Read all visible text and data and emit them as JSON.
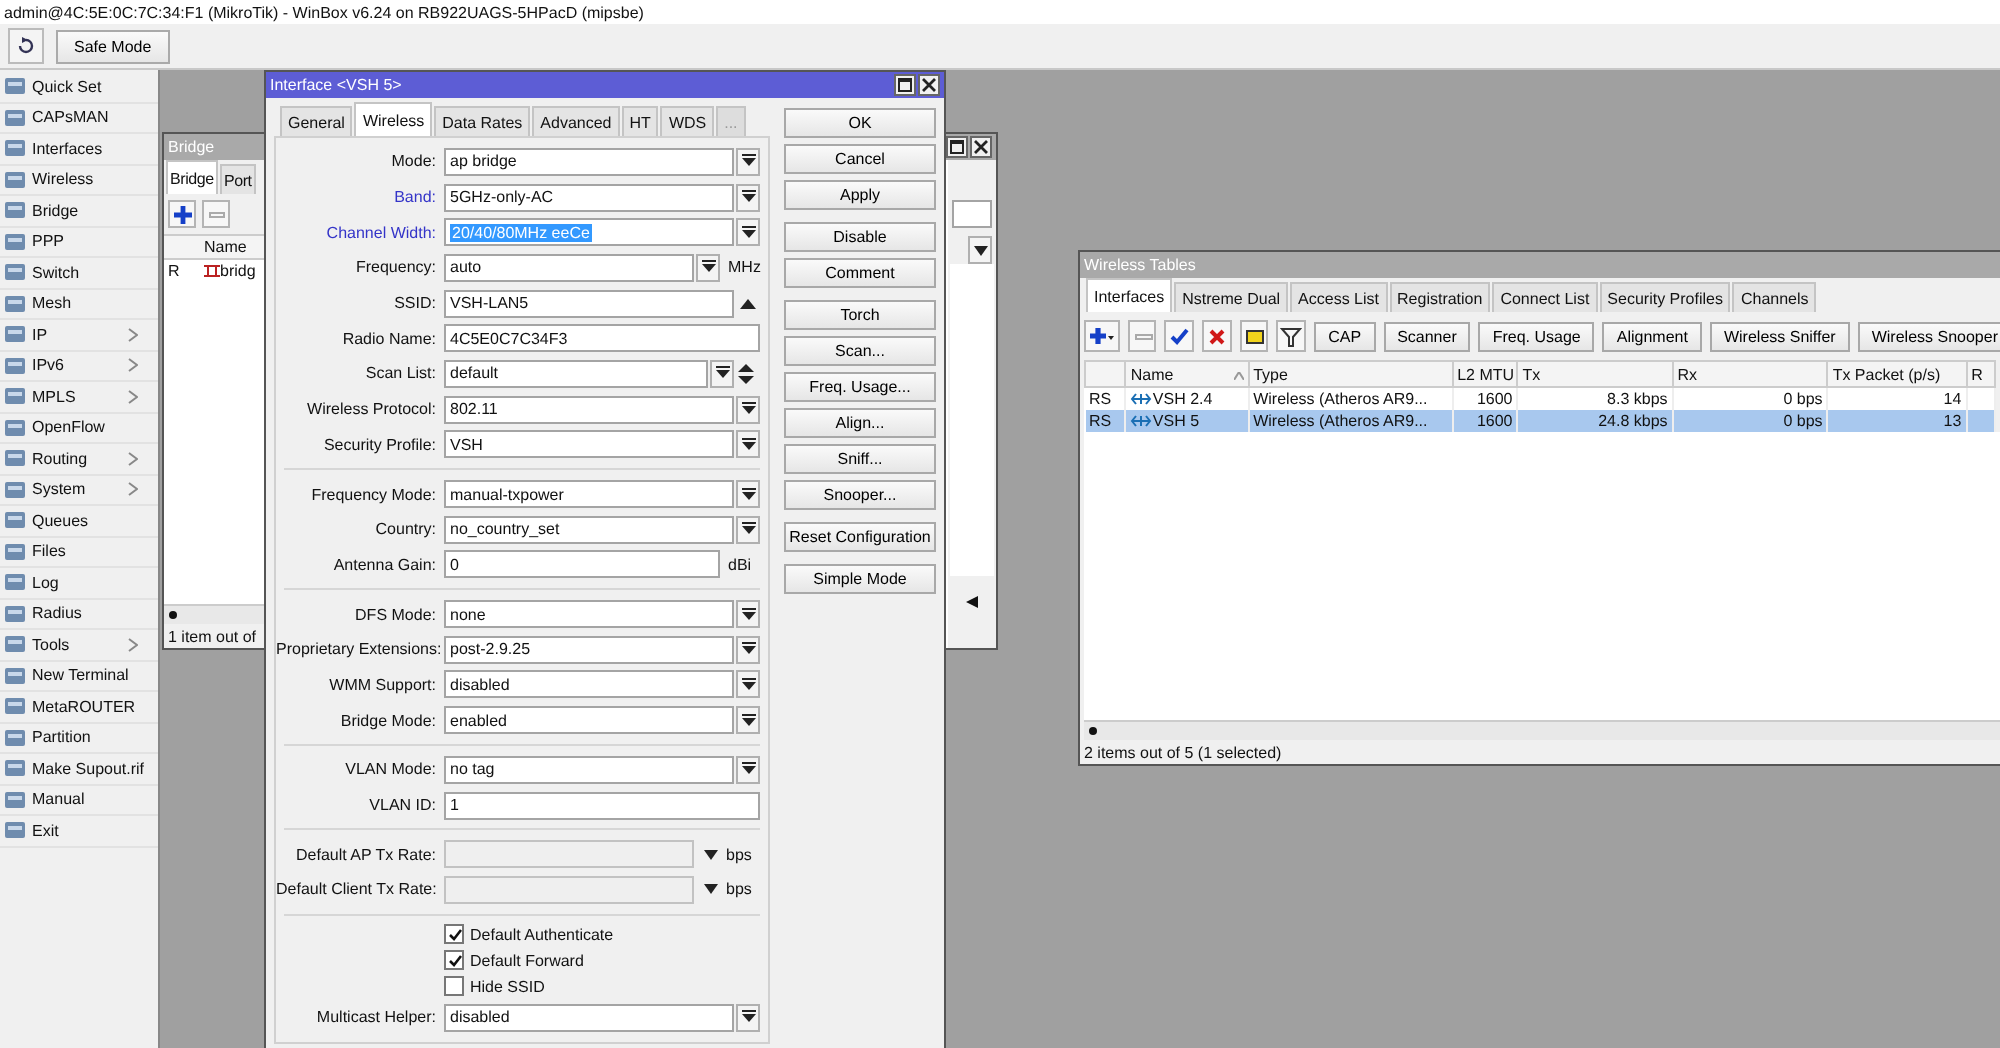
{
  "app_title": "admin@4C:5E:0C:7C:34:F1 (MikroTik) - WinBox v6.24 on RB922UAGS-5HPacD (mipsbe)",
  "toolbar": {
    "safe_mode": "Safe Mode"
  },
  "sidebar": {
    "items": [
      {
        "label": "Quick Set",
        "submenu": false
      },
      {
        "label": "CAPsMAN",
        "submenu": false
      },
      {
        "label": "Interfaces",
        "submenu": false
      },
      {
        "label": "Wireless",
        "submenu": false
      },
      {
        "label": "Bridge",
        "submenu": false
      },
      {
        "label": "PPP",
        "submenu": false
      },
      {
        "label": "Switch",
        "submenu": false
      },
      {
        "label": "Mesh",
        "submenu": false
      },
      {
        "label": "IP",
        "submenu": true
      },
      {
        "label": "IPv6",
        "submenu": true
      },
      {
        "label": "MPLS",
        "submenu": true
      },
      {
        "label": "OpenFlow",
        "submenu": false
      },
      {
        "label": "Routing",
        "submenu": true
      },
      {
        "label": "System",
        "submenu": true
      },
      {
        "label": "Queues",
        "submenu": false
      },
      {
        "label": "Files",
        "submenu": false
      },
      {
        "label": "Log",
        "submenu": false
      },
      {
        "label": "Radius",
        "submenu": false
      },
      {
        "label": "Tools",
        "submenu": true
      },
      {
        "label": "New Terminal",
        "submenu": false
      },
      {
        "label": "MetaROUTER",
        "submenu": false
      },
      {
        "label": "Partition",
        "submenu": false
      },
      {
        "label": "Make Supout.rif",
        "submenu": false
      },
      {
        "label": "Manual",
        "submenu": false
      },
      {
        "label": "Exit",
        "submenu": false
      }
    ]
  },
  "bridge_window": {
    "title": "Bridge",
    "tabs": [
      {
        "label": "Bridge",
        "selected": true
      },
      {
        "label": "Port",
        "selected": false
      }
    ],
    "columns": [
      "Name"
    ],
    "rows": [
      {
        "flags": "R",
        "name": "bridg"
      }
    ],
    "status": "1 item out of"
  },
  "interface_dialog": {
    "title": "Interface <VSH 5>",
    "tabs": [
      {
        "label": "General",
        "selected": false,
        "disabled": false
      },
      {
        "label": "Wireless",
        "selected": true,
        "disabled": false
      },
      {
        "label": "Data Rates",
        "selected": false,
        "disabled": false
      },
      {
        "label": "Advanced",
        "selected": false,
        "disabled": false
      },
      {
        "label": "HT",
        "selected": false,
        "disabled": false
      },
      {
        "label": "WDS",
        "selected": false,
        "disabled": false
      },
      {
        "label": "...",
        "selected": false,
        "disabled": true
      }
    ],
    "sections": [
      [
        {
          "kind": "select",
          "label": "Mode:",
          "value": "ap bridge",
          "highlighted": false,
          "selected": false
        },
        {
          "kind": "select",
          "label": "Band:",
          "value": "5GHz-only-AC",
          "highlighted": true,
          "selected": false
        },
        {
          "kind": "select",
          "label": "Channel Width:",
          "value": "20/40/80MHz eeCe",
          "highlighted": true,
          "selected": true
        },
        {
          "kind": "combo",
          "label": "Frequency:",
          "value": "auto",
          "unit": "MHz",
          "highlighted": false,
          "selected": false
        },
        {
          "kind": "ssid",
          "label": "SSID:",
          "value": "VSH-LAN5",
          "highlighted": false,
          "selected": false
        },
        {
          "kind": "text",
          "label": "Radio Name:",
          "value": "4C5E0C7C34F3",
          "highlighted": false,
          "selected": false
        },
        {
          "kind": "scan",
          "label": "Scan List:",
          "value": "default",
          "highlighted": false,
          "selected": false
        },
        {
          "kind": "select",
          "label": "Wireless Protocol:",
          "value": "802.11",
          "highlighted": false,
          "selected": false
        },
        {
          "kind": "select",
          "label": "Security Profile:",
          "value": "VSH",
          "highlighted": false,
          "selected": false
        }
      ],
      [
        {
          "kind": "select",
          "label": "Frequency Mode:",
          "value": "manual-txpower",
          "highlighted": false,
          "selected": false
        },
        {
          "kind": "select",
          "label": "Country:",
          "value": "no_country_set",
          "highlighted": false,
          "selected": false
        },
        {
          "kind": "unit",
          "label": "Antenna Gain:",
          "value": "0",
          "unit": "dBi",
          "highlighted": false,
          "selected": false
        }
      ],
      [
        {
          "kind": "select",
          "label": "DFS Mode:",
          "value": "none",
          "highlighted": false,
          "selected": false
        },
        {
          "kind": "select",
          "label": "Proprietary Extensions:",
          "value": "post-2.9.25",
          "highlighted": false,
          "selected": false
        },
        {
          "kind": "select",
          "label": "WMM Support:",
          "value": "disabled",
          "highlighted": false,
          "selected": false
        },
        {
          "kind": "select",
          "label": "Bridge Mode:",
          "value": "enabled",
          "highlighted": false,
          "selected": false
        }
      ],
      [
        {
          "kind": "select",
          "label": "VLAN Mode:",
          "value": "no tag",
          "highlighted": false,
          "selected": false
        },
        {
          "kind": "text",
          "label": "VLAN ID:",
          "value": "1",
          "highlighted": false,
          "selected": false
        }
      ],
      [
        {
          "kind": "rate",
          "label": "Default AP Tx Rate:",
          "unit": "bps",
          "highlighted": false
        },
        {
          "kind": "rate",
          "label": "Default Client Tx Rate:",
          "unit": "bps",
          "highlighted": false
        }
      ],
      [
        {
          "kind": "checkbox",
          "label": "Default Authenticate",
          "checked": true
        },
        {
          "kind": "checkbox",
          "label": "Default Forward",
          "checked": true
        },
        {
          "kind": "checkbox",
          "label": "Hide SSID",
          "checked": false
        },
        {
          "kind": "select",
          "label": "Multicast Helper:",
          "value": "disabled",
          "highlighted": false,
          "selected": false
        }
      ]
    ],
    "buttons": [
      [
        "OK",
        "Cancel",
        "Apply"
      ],
      [
        "Disable",
        "Comment"
      ],
      [
        "Torch",
        "Scan...",
        "Freq. Usage...",
        "Align...",
        "Sniff...",
        "Snooper..."
      ],
      [
        "Reset Configuration"
      ],
      [
        "Simple Mode"
      ]
    ]
  },
  "wireless_tables": {
    "title": "Wireless Tables",
    "tabs": [
      {
        "label": "Interfaces",
        "selected": true
      },
      {
        "label": "Nstreme Dual",
        "selected": false
      },
      {
        "label": "Access List",
        "selected": false
      },
      {
        "label": "Registration",
        "selected": false
      },
      {
        "label": "Connect List",
        "selected": false
      },
      {
        "label": "Security Profiles",
        "selected": false
      },
      {
        "label": "Channels",
        "selected": false
      }
    ],
    "buttons": [
      "CAP",
      "Scanner",
      "Freq. Usage",
      "Alignment",
      "Wireless Sniffer",
      "Wireless Snooper"
    ],
    "columns": [
      {
        "label": "Name",
        "sorted": true
      },
      {
        "label": "Type",
        "sorted": false
      },
      {
        "label": "L2 MTU",
        "sorted": false
      },
      {
        "label": "Tx",
        "sorted": false
      },
      {
        "label": "Rx",
        "sorted": false
      },
      {
        "label": "Tx Packet (p/s)",
        "sorted": false
      },
      {
        "label": "R",
        "sorted": false
      }
    ],
    "rows": [
      {
        "flags": "RS",
        "name": "VSH 2.4",
        "type": "Wireless (Atheros AR9...",
        "l2_mtu": "1600",
        "tx": "8.3 kbps",
        "rx": "0 bps",
        "tx_packet": "14",
        "selected": false
      },
      {
        "flags": "RS",
        "name": "VSH 5",
        "type": "Wireless (Atheros AR9...",
        "l2_mtu": "1600",
        "tx": "24.8 kbps",
        "rx": "0 bps",
        "tx_packet": "13",
        "selected": true
      }
    ],
    "status": "2 items out of 5 (1 selected)"
  }
}
